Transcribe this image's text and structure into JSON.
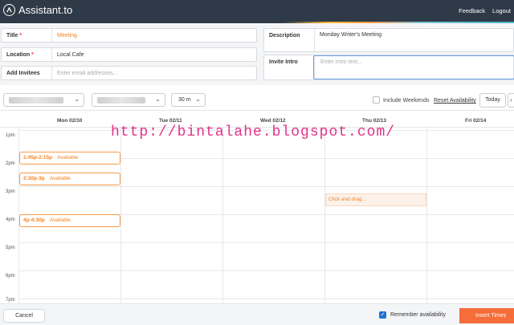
{
  "app": {
    "name": "Assistant.to",
    "links": [
      "Feedback",
      "Logout"
    ]
  },
  "form": {
    "title_label": "Title",
    "title_value": "Meeting",
    "location_label": "Location",
    "location_value": "Local Cafe",
    "invitees_label": "Add Invitees",
    "invitees_placeholder": "Enter email addresses...",
    "description_label": "Description",
    "description_value": "Monday Writer's Meeting",
    "intro_label": "Invite Intro",
    "intro_placeholder": "Enter Intro text..."
  },
  "toolbar": {
    "duration": "30 m",
    "include_weekends": "Include Weekends",
    "reset": "Reset Availability",
    "today": "Today",
    "next": "›"
  },
  "calendar": {
    "days": [
      "Mon 02/10",
      "Tue 02/11",
      "Wed 02/12",
      "Thu 02/13",
      "Fri 02/14"
    ],
    "hours": [
      "1pm",
      "2pm",
      "3pm",
      "4pm",
      "5pm",
      "6pm",
      "7pm"
    ],
    "slots": [
      {
        "time": "1:45p-2:15p",
        "status": "Available"
      },
      {
        "time": "2:30p-3p",
        "status": "Available"
      },
      {
        "time": "4p-4:30p",
        "status": "Available"
      }
    ],
    "drag_hint": "Click and drag..."
  },
  "watermark": "http://bintalahe.blogspot.com/",
  "footer": {
    "cancel": "Cancel",
    "remember": "Remember availability",
    "insert": "Insert Times"
  },
  "colors": {
    "accent": "#f58220",
    "topbar": "#2f3a48",
    "insert_button": "#f56d3b",
    "checkbox": "#1f6fd1"
  },
  "icons": {
    "logo": "assistant-logo-icon",
    "dropdown": "chevron-down-icon",
    "next": "chevron-right-icon",
    "check": "check-icon"
  }
}
